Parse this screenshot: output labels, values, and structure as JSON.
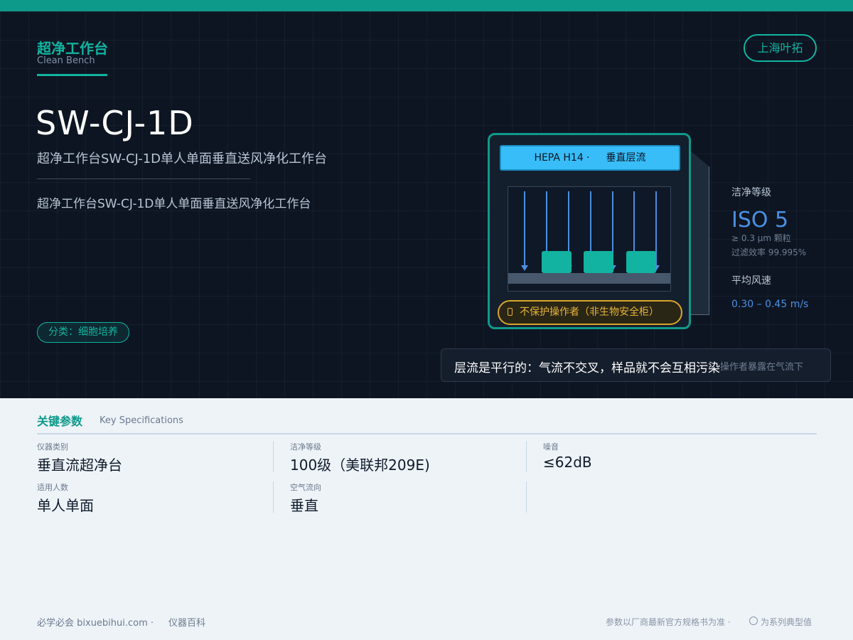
{
  "category": {
    "title": "超净工作台",
    "subtitle": "Clean Bench"
  },
  "brand": "上海叶拓",
  "model": "SW-CJ-1D",
  "description_primary": "超净工作台SW-CJ-1D单人单面垂直送风净化工作台",
  "description_secondary": "超净工作台SW-CJ-1D单人单面垂直送风净化工作台",
  "tag": "分类：细胞培养",
  "diagram": {
    "hepa_label": "HEPA H14 ·",
    "flow_label": "垂直层流",
    "warning": "不保护操作者（非生物安全柜）"
  },
  "side_stats": {
    "cleanliness_label": "洁净等级",
    "cleanliness_value": "ISO 5",
    "particle_note": "≥ 0.3 μm 颗粒",
    "efficiency_note": "过滤效率 99.995%",
    "airspeed_label": "平均风速",
    "airspeed_value": "0.30 – 0.45 m/s"
  },
  "callout": {
    "main": "层流是平行的：气流不交叉，样品就不会互相污染",
    "ghost": "操作者暴露在气流下"
  },
  "specs": {
    "title": "关键参数",
    "subtitle": "Key Specifications",
    "items": [
      {
        "label": "仪器类别",
        "value": "垂直流超净台"
      },
      {
        "label": "洁净等级",
        "value": "100级（美联邦209E)"
      },
      {
        "label": "噪音",
        "value": "≤62dB"
      },
      {
        "label": "适用人数",
        "value": "单人单面"
      },
      {
        "label": "空气流向",
        "value": "垂直"
      }
    ]
  },
  "footer": {
    "site": "必学必会 bixuebihui.com ·",
    "section": "仪器百科",
    "disclaimer": "参数以厂商最新官方规格书为准 ·",
    "note": "为系列典型值"
  },
  "colors": {
    "accent": "#12b3a0",
    "topbar": "#0e9a8a",
    "hepa": "#38bdf8",
    "warning": "#e6b43a",
    "link": "#4a90e2"
  }
}
